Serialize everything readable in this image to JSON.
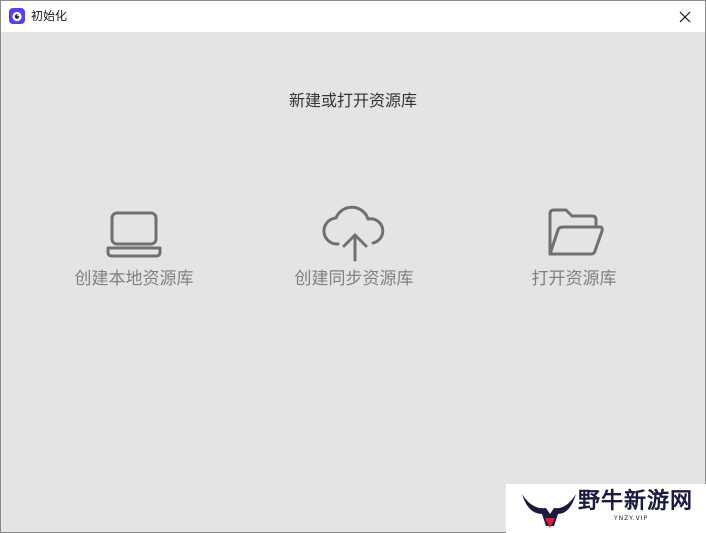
{
  "window": {
    "title": "初始化",
    "close_icon": "close-icon",
    "app_icon": "app-logo-icon"
  },
  "main": {
    "heading": "新建或打开资源库",
    "options": [
      {
        "label": "创建本地资源库",
        "icon": "laptop-icon"
      },
      {
        "label": "创建同步资源库",
        "icon": "cloud-upload-icon"
      },
      {
        "label": "打开资源库",
        "icon": "folder-open-icon"
      }
    ]
  },
  "watermark": {
    "text": "野牛新游网",
    "subtext": "YNZY.VIP"
  },
  "colors": {
    "background": "#e4e4e4",
    "icon_stroke": "#707070",
    "label": "#808080",
    "app_icon_accent": "#5b3df5"
  }
}
